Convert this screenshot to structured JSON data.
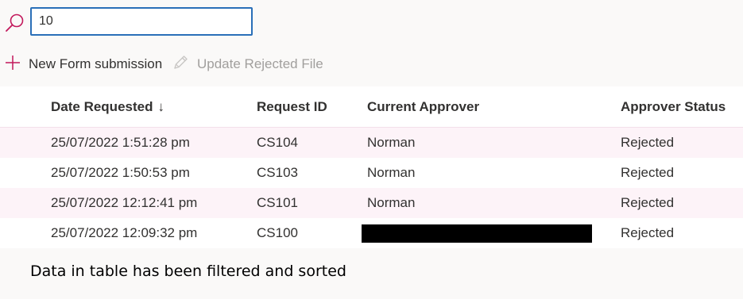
{
  "search": {
    "value": "10"
  },
  "command_bar": {
    "new_label": "New Form submission",
    "update_label": "Update Rejected File"
  },
  "table": {
    "columns": [
      "Date Requested",
      "Request ID",
      "Current Approver",
      "Approver Status"
    ],
    "sort_indicator": "↓",
    "rows": [
      {
        "date": "25/07/2022 1:51:28 pm",
        "id": "CS104",
        "approver": "Norman",
        "status": "Rejected"
      },
      {
        "date": "25/07/2022 1:50:53 pm",
        "id": "CS103",
        "approver": "Norman",
        "status": "Rejected"
      },
      {
        "date": "25/07/2022 12:12:41 pm",
        "id": "CS101",
        "approver": "Norman",
        "status": "Rejected"
      },
      {
        "date": "25/07/2022 12:09:32 pm",
        "id": "CS100",
        "approver": "",
        "status": "Rejected"
      }
    ]
  },
  "caption": "Data in table has been filtered and sorted",
  "colors": {
    "accent": "#c2185b",
    "input_border": "#2a6fb8",
    "row_alt": "#fdf3f8",
    "disabled_text": "#a19f9d"
  },
  "icons": {
    "search": "search-icon",
    "add": "plus-icon",
    "edit": "pencil-icon"
  }
}
